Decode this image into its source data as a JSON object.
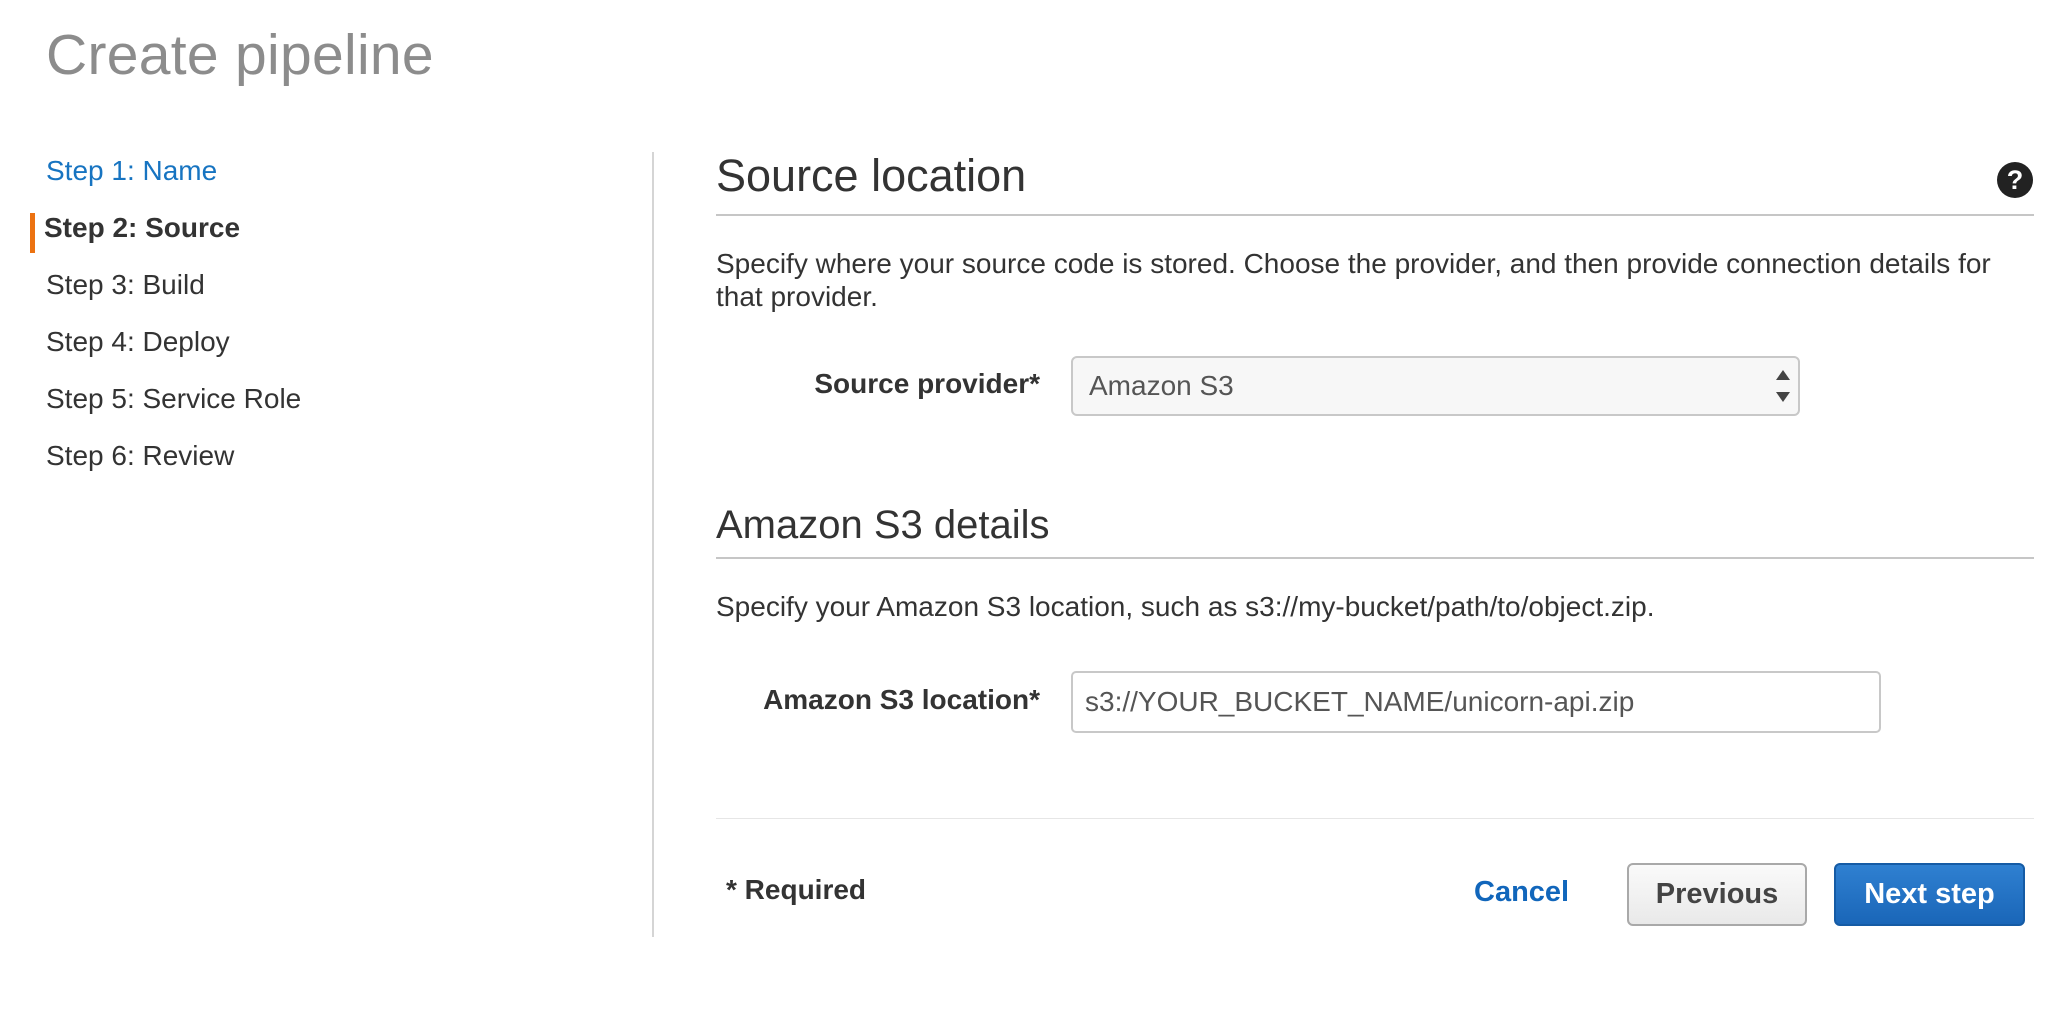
{
  "page": {
    "title": "Create pipeline"
  },
  "steps": [
    {
      "label": "Step 1: Name",
      "state": "link"
    },
    {
      "label": "Step 2: Source",
      "state": "active"
    },
    {
      "label": "Step 3: Build",
      "state": "default"
    },
    {
      "label": "Step 4: Deploy",
      "state": "default"
    },
    {
      "label": "Step 5: Service Role",
      "state": "default"
    },
    {
      "label": "Step 6: Review",
      "state": "default"
    }
  ],
  "source_section": {
    "title": "Source location",
    "help_icon": "?",
    "description": "Specify where your source code is stored. Choose the provider, and then provide connection details for that provider.",
    "provider_label": "Source provider*",
    "provider_value": "Amazon S3"
  },
  "s3_section": {
    "title": "Amazon S3 details",
    "description": "Specify your Amazon S3 location, such as s3://my-bucket/path/to/object.zip.",
    "location_label": "Amazon S3 location*",
    "location_value": "s3://YOUR_BUCKET_NAME/unicorn-api.zip"
  },
  "footer": {
    "required_note": "* Required",
    "cancel_label": "Cancel",
    "previous_label": "Previous",
    "next_label": "Next step"
  },
  "colors": {
    "link": "#1774c1",
    "active_step_marker": "#ec7211",
    "primary_button": "#1f6fc5"
  }
}
